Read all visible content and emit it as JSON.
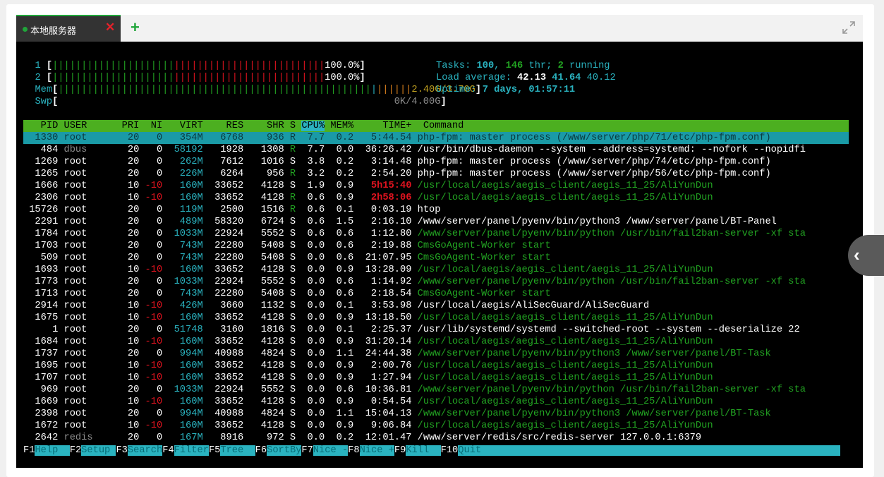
{
  "tab": {
    "label": "本地服务器"
  },
  "meters": {
    "cpu1": {
      "label": "1",
      "value": "100.0%"
    },
    "cpu2": {
      "label": "2",
      "value": "100.0%"
    },
    "mem": {
      "label": "Mem",
      "value": "2.40G/3.70G"
    },
    "swp": {
      "label": "Swp",
      "value": "0K/4.00G"
    }
  },
  "stats": {
    "tasks_label": "Tasks:",
    "tasks": "100",
    "thr": "146",
    "thr_label": "thr;",
    "running": "2",
    "running_label": "running",
    "load_label": "Load average:",
    "load1": "42.13",
    "load5": "41.64",
    "load15": "40.12",
    "uptime_label": "Uptime:",
    "uptime": "7 days, 01:57:11"
  },
  "columns": [
    "PID",
    "USER",
    "PRI",
    "NI",
    "VIRT",
    "RES",
    "SHR",
    "S",
    "CPU%",
    "MEM%",
    "TIME+",
    "Command"
  ],
  "processes": [
    {
      "pid": "1330",
      "user": "root",
      "pri": "20",
      "ni": "0",
      "virt": "354M",
      "res": "6768",
      "shr": "936",
      "s": "R",
      "cpu": "7.7",
      "mem": "0.2",
      "time": "5:44.54",
      "cmd": "php-fpm: master process (/www/server/php/71/etc/php-fpm.conf)"
    },
    {
      "pid": "484",
      "user": "dbus",
      "pri": "20",
      "ni": "0",
      "virt": "58192",
      "res": "1928",
      "shr": "1308",
      "s": "R",
      "cpu": "7.7",
      "mem": "0.0",
      "time": "36:26.42",
      "cmd": "/usr/bin/dbus-daemon --system --address=systemd: --nofork --nopidfi"
    },
    {
      "pid": "1269",
      "user": "root",
      "pri": "20",
      "ni": "0",
      "virt": "262M",
      "res": "7612",
      "shr": "1016",
      "s": "S",
      "cpu": "3.8",
      "mem": "0.2",
      "time": "3:14.48",
      "cmd": "php-fpm: master process (/www/server/php/74/etc/php-fpm.conf)"
    },
    {
      "pid": "1265",
      "user": "root",
      "pri": "20",
      "ni": "0",
      "virt": "226M",
      "res": "6264",
      "shr": "956",
      "s": "R",
      "cpu": "3.2",
      "mem": "0.2",
      "time": "2:54.20",
      "cmd": "php-fpm: master process (/www/server/php/56/etc/php-fpm.conf)"
    },
    {
      "pid": "1666",
      "user": "root",
      "pri": "10",
      "ni": "-10",
      "virt": "160M",
      "res": "33652",
      "shr": "4128",
      "s": "S",
      "cpu": "1.9",
      "mem": "0.9",
      "time": "5h15:40",
      "cmd": "/usr/local/aegis/aegis_client/aegis_11_25/AliYunDun"
    },
    {
      "pid": "2306",
      "user": "root",
      "pri": "10",
      "ni": "-10",
      "virt": "160M",
      "res": "33652",
      "shr": "4128",
      "s": "R",
      "cpu": "0.6",
      "mem": "0.9",
      "time": "2h58:06",
      "cmd": "/usr/local/aegis/aegis_client/aegis_11_25/AliYunDun"
    },
    {
      "pid": "15726",
      "user": "root",
      "pri": "20",
      "ni": "0",
      "virt": "119M",
      "res": "2500",
      "shr": "1516",
      "s": "R",
      "cpu": "0.6",
      "mem": "0.1",
      "time": "0:03.19",
      "cmd": "htop"
    },
    {
      "pid": "2291",
      "user": "root",
      "pri": "20",
      "ni": "0",
      "virt": "489M",
      "res": "58320",
      "shr": "6724",
      "s": "S",
      "cpu": "0.6",
      "mem": "1.5",
      "time": "2:16.10",
      "cmd": "/www/server/panel/pyenv/bin/python3 /www/server/panel/BT-Panel"
    },
    {
      "pid": "1784",
      "user": "root",
      "pri": "20",
      "ni": "0",
      "virt": "1033M",
      "res": "22924",
      "shr": "5552",
      "s": "S",
      "cpu": "0.6",
      "mem": "0.6",
      "time": "1:12.80",
      "cmd": "/www/server/panel/pyenv/bin/python /usr/bin/fail2ban-server -xf sta"
    },
    {
      "pid": "1703",
      "user": "root",
      "pri": "20",
      "ni": "0",
      "virt": "743M",
      "res": "22280",
      "shr": "5408",
      "s": "S",
      "cpu": "0.0",
      "mem": "0.6",
      "time": "2:19.88",
      "cmd": "CmsGoAgent-Worker start"
    },
    {
      "pid": "509",
      "user": "root",
      "pri": "20",
      "ni": "0",
      "virt": "743M",
      "res": "22280",
      "shr": "5408",
      "s": "S",
      "cpu": "0.0",
      "mem": "0.6",
      "time": "21:07.95",
      "cmd": "CmsGoAgent-Worker start"
    },
    {
      "pid": "1693",
      "user": "root",
      "pri": "10",
      "ni": "-10",
      "virt": "160M",
      "res": "33652",
      "shr": "4128",
      "s": "S",
      "cpu": "0.0",
      "mem": "0.9",
      "time": "13:28.09",
      "cmd": "/usr/local/aegis/aegis_client/aegis_11_25/AliYunDun"
    },
    {
      "pid": "1773",
      "user": "root",
      "pri": "20",
      "ni": "0",
      "virt": "1033M",
      "res": "22924",
      "shr": "5552",
      "s": "S",
      "cpu": "0.0",
      "mem": "0.6",
      "time": "1:14.92",
      "cmd": "/www/server/panel/pyenv/bin/python /usr/bin/fail2ban-server -xf sta"
    },
    {
      "pid": "1713",
      "user": "root",
      "pri": "20",
      "ni": "0",
      "virt": "743M",
      "res": "22280",
      "shr": "5408",
      "s": "S",
      "cpu": "0.0",
      "mem": "0.6",
      "time": "2:18.54",
      "cmd": "CmsGoAgent-Worker start"
    },
    {
      "pid": "2914",
      "user": "root",
      "pri": "10",
      "ni": "-10",
      "virt": "426M",
      "res": "3660",
      "shr": "1132",
      "s": "S",
      "cpu": "0.0",
      "mem": "0.1",
      "time": "3:53.98",
      "cmd": "/usr/local/aegis/AliSecGuard/AliSecGuard"
    },
    {
      "pid": "1675",
      "user": "root",
      "pri": "10",
      "ni": "-10",
      "virt": "160M",
      "res": "33652",
      "shr": "4128",
      "s": "S",
      "cpu": "0.0",
      "mem": "0.9",
      "time": "13:18.50",
      "cmd": "/usr/local/aegis/aegis_client/aegis_11_25/AliYunDun"
    },
    {
      "pid": "1",
      "user": "root",
      "pri": "20",
      "ni": "0",
      "virt": "51748",
      "res": "3160",
      "shr": "1816",
      "s": "S",
      "cpu": "0.0",
      "mem": "0.1",
      "time": "2:25.37",
      "cmd": "/usr/lib/systemd/systemd --switched-root --system --deserialize 22"
    },
    {
      "pid": "1684",
      "user": "root",
      "pri": "10",
      "ni": "-10",
      "virt": "160M",
      "res": "33652",
      "shr": "4128",
      "s": "S",
      "cpu": "0.0",
      "mem": "0.9",
      "time": "31:20.14",
      "cmd": "/usr/local/aegis/aegis_client/aegis_11_25/AliYunDun"
    },
    {
      "pid": "1737",
      "user": "root",
      "pri": "20",
      "ni": "0",
      "virt": "994M",
      "res": "40988",
      "shr": "4824",
      "s": "S",
      "cpu": "0.0",
      "mem": "1.1",
      "time": "24:44.38",
      "cmd": "/www/server/panel/pyenv/bin/python3 /www/server/panel/BT-Task"
    },
    {
      "pid": "1695",
      "user": "root",
      "pri": "10",
      "ni": "-10",
      "virt": "160M",
      "res": "33652",
      "shr": "4128",
      "s": "S",
      "cpu": "0.0",
      "mem": "0.9",
      "time": "2:00.76",
      "cmd": "/usr/local/aegis/aegis_client/aegis_11_25/AliYunDun"
    },
    {
      "pid": "1707",
      "user": "root",
      "pri": "10",
      "ni": "-10",
      "virt": "160M",
      "res": "33652",
      "shr": "4128",
      "s": "S",
      "cpu": "0.0",
      "mem": "0.9",
      "time": "1:27.94",
      "cmd": "/usr/local/aegis/aegis_client/aegis_11_25/AliYunDun"
    },
    {
      "pid": "969",
      "user": "root",
      "pri": "20",
      "ni": "0",
      "virt": "1033M",
      "res": "22924",
      "shr": "5552",
      "s": "S",
      "cpu": "0.0",
      "mem": "0.6",
      "time": "10:36.81",
      "cmd": "/www/server/panel/pyenv/bin/python /usr/bin/fail2ban-server -xf sta"
    },
    {
      "pid": "1669",
      "user": "root",
      "pri": "10",
      "ni": "-10",
      "virt": "160M",
      "res": "33652",
      "shr": "4128",
      "s": "S",
      "cpu": "0.0",
      "mem": "0.9",
      "time": "0:54.54",
      "cmd": "/usr/local/aegis/aegis_client/aegis_11_25/AliYunDun"
    },
    {
      "pid": "2398",
      "user": "root",
      "pri": "20",
      "ni": "0",
      "virt": "994M",
      "res": "40988",
      "shr": "4824",
      "s": "S",
      "cpu": "0.0",
      "mem": "1.1",
      "time": "15:04.13",
      "cmd": "/www/server/panel/pyenv/bin/python3 /www/server/panel/BT-Task"
    },
    {
      "pid": "1672",
      "user": "root",
      "pri": "10",
      "ni": "-10",
      "virt": "160M",
      "res": "33652",
      "shr": "4128",
      "s": "S",
      "cpu": "0.0",
      "mem": "0.9",
      "time": "9:06.84",
      "cmd": "/usr/local/aegis/aegis_client/aegis_11_25/AliYunDun"
    },
    {
      "pid": "2642",
      "user": "redis",
      "pri": "20",
      "ni": "0",
      "virt": "167M",
      "res": "8916",
      "shr": "972",
      "s": "S",
      "cpu": "0.0",
      "mem": "0.2",
      "time": "12:01.47",
      "cmd": "/www/server/redis/src/redis-server 127.0.0.1:6379"
    }
  ],
  "fkeys": [
    {
      "key": "F1",
      "label": "Help  "
    },
    {
      "key": "F2",
      "label": "Setup "
    },
    {
      "key": "F3",
      "label": "Search"
    },
    {
      "key": "F4",
      "label": "Filter"
    },
    {
      "key": "F5",
      "label": "Tree  "
    },
    {
      "key": "F6",
      "label": "SortBy"
    },
    {
      "key": "F7",
      "label": "Nice -"
    },
    {
      "key": "F8",
      "label": "Nice +"
    },
    {
      "key": "F9",
      "label": "Kill  "
    },
    {
      "key": "F10",
      "label": "Quit"
    }
  ],
  "colors": {
    "accent": "#20a53a",
    "close": "#e8212a",
    "header_bg": "#4caf20",
    "highlight": "#2ab3c0"
  }
}
